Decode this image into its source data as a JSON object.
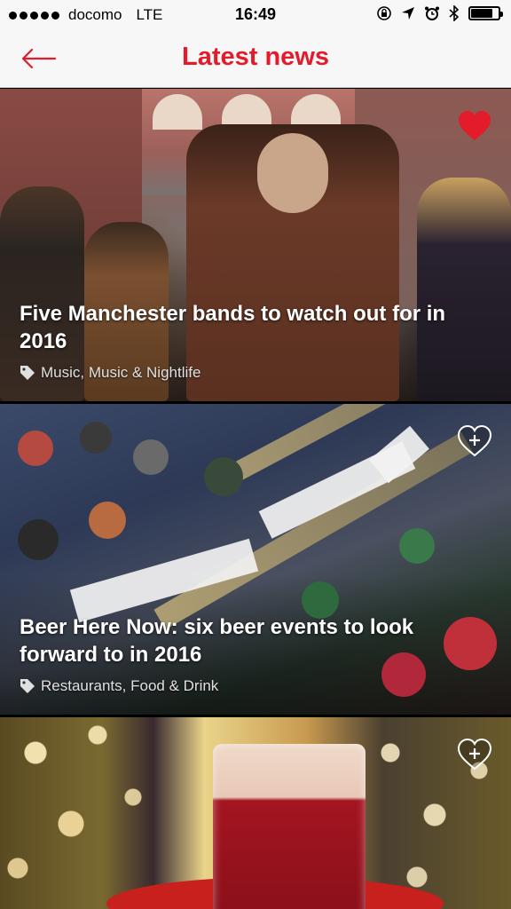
{
  "status_bar": {
    "carrier": "docomo",
    "network": "LTE",
    "time": "16:49",
    "battery_level": 0.8
  },
  "nav": {
    "title": "Latest news",
    "back_icon": "arrow-left-icon"
  },
  "colors": {
    "accent": "#e31b2a",
    "nav_background": "#f7f7f7"
  },
  "feed": {
    "items": [
      {
        "title": "Five Manchester bands to watch out for in 2016",
        "category": "Music, Music & Nightlife",
        "category_icon": "tag-icon",
        "favorited": true,
        "fav_icon": "heart-filled-icon"
      },
      {
        "title": "Beer Here Now: six beer events to look forward to in 2016",
        "category": "Restaurants, Food & Drink",
        "category_icon": "tag-icon",
        "favorited": false,
        "fav_icon": "heart-add-icon"
      },
      {
        "title": "",
        "category": "",
        "favorited": false,
        "fav_icon": "heart-add-icon"
      }
    ]
  }
}
